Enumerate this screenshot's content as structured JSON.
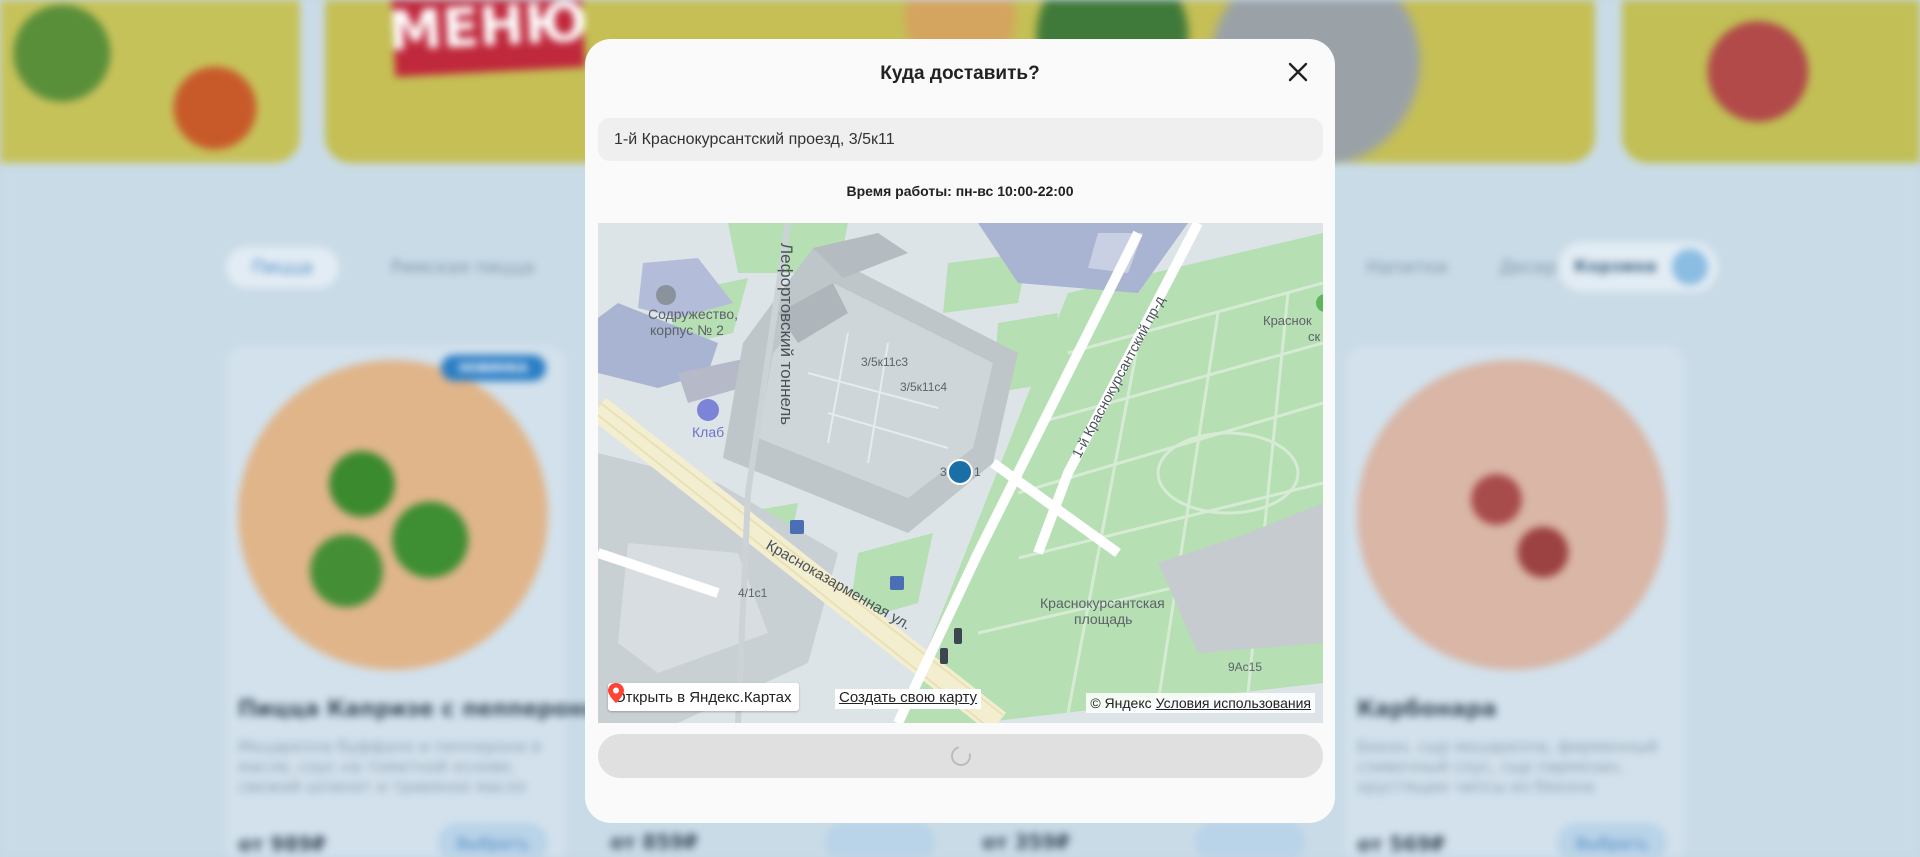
{
  "background_page": {
    "banner_menu_text": "МЕНЮ",
    "categories": [
      "Пицца",
      "Римская пицца",
      "Напитки",
      "Десерты"
    ],
    "cart_label": "Корзина",
    "cards": [
      {
        "badge": "НОВИНКА",
        "title": "Пицца Капризе с пепперони",
        "description": "Моцарелла буффало и пепперони в масле, соус на томатной основе, свежий шпинат и травяное масло",
        "price": "от 989₽",
        "button": "Выбрать"
      },
      {
        "title": "Карбонара",
        "description": "Бекон, сыр моцарелла, фирменный сливочный соус, сыр пармезан, хрустящие чипсы из бекона",
        "price": "от 569₽",
        "button": "Выбрать"
      }
    ],
    "middle_prices": [
      "от 859₽",
      "от 359₽"
    ]
  },
  "modal": {
    "title": "Куда доставить?",
    "address_value": "1-й Краснокурсантский проезд, 3/5к11",
    "working_hours": "Время работы: пн-вс 10:00-22:00",
    "close_icon": "close-icon",
    "submit_state": "loading"
  },
  "map": {
    "labels": {
      "poi_1_line1": "Содружество,",
      "poi_1_line2": "корпус № 2",
      "poi_2": "Клаб",
      "street_1": "Лефортовский тоннель",
      "street_2": "1-й Краснокурсантский пр-д",
      "street_3": "Красноказарменная ул.",
      "square_line1": "Краснокурсантская",
      "square_line2": "площадь",
      "edge_label_1": "Краснок",
      "edge_label_2": "ск",
      "bld_1": "3/5к11с3",
      "bld_2": "3/5к11с4",
      "bld_3": "4/1с1",
      "bld_4": "9Ас15",
      "bld_pin_left": "3",
      "bld_pin_right": "1"
    },
    "open_in_maps": "Открыть в Яндекс.Картах",
    "create_map": "Создать свою карту",
    "copyright": "© Яндекс",
    "terms": "Условия использования",
    "marker_color": "#1a6fa6",
    "park_color": "#b6dfb4"
  }
}
